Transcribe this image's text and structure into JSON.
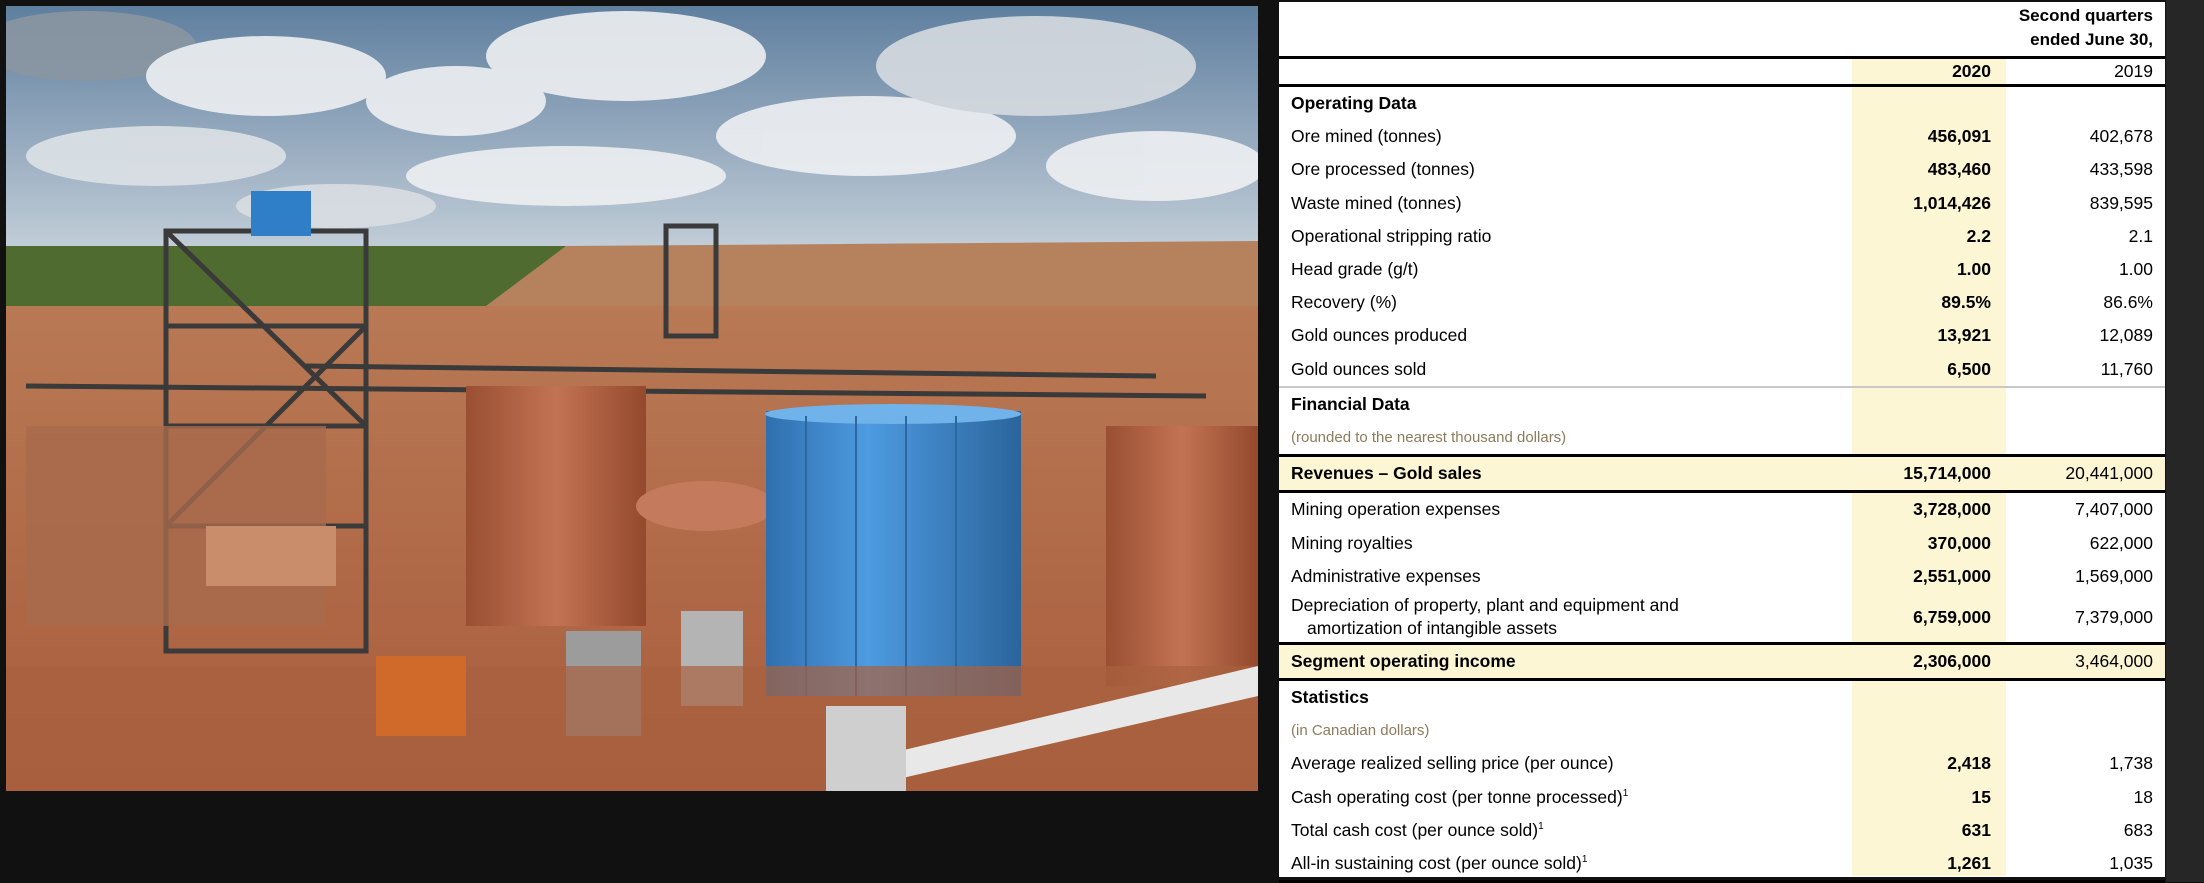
{
  "header": {
    "period_line1": "Second quarters",
    "period_line2": "ended June 30,",
    "col_2020": "2020",
    "col_2019": "2019"
  },
  "rows": [
    {
      "type": "section",
      "label": "Operating Data"
    },
    {
      "type": "data",
      "label": "Ore mined (tonnes)",
      "v2020": "456,091",
      "v2019": "402,678"
    },
    {
      "type": "data",
      "label": "Ore processed  (tonnes)",
      "v2020": "483,460",
      "v2019": "433,598"
    },
    {
      "type": "data",
      "label": "Waste mined (tonnes)",
      "v2020": "1,014,426",
      "v2019": "839,595"
    },
    {
      "type": "data",
      "label": "Operational stripping ratio",
      "v2020": "2.2",
      "v2019": "2.1"
    },
    {
      "type": "data",
      "label": "Head grade  (g/t)",
      "v2020": "1.00",
      "v2019": "1.00"
    },
    {
      "type": "data",
      "label": "Recovery (%)",
      "v2020": "89.5%",
      "v2019": "86.6%"
    },
    {
      "type": "data",
      "label": "Gold ounces produced",
      "v2020": "13,921",
      "v2019": "12,089"
    },
    {
      "type": "data",
      "label": "Gold ounces sold",
      "v2020": "6,500",
      "v2019": "11,760",
      "after": "gray"
    },
    {
      "type": "section",
      "label": "Financial Data"
    },
    {
      "type": "note",
      "label": "(rounded to the nearest thousand dollars)",
      "after": "thick"
    },
    {
      "type": "hl",
      "label": "Revenues – Gold sales",
      "v2020": "15,714,000",
      "v2019": "20,441,000",
      "after": "thick"
    },
    {
      "type": "data",
      "label": "Mining operation expenses",
      "v2020": "3,728,000",
      "v2019": "7,407,000"
    },
    {
      "type": "data",
      "label": "Mining royalties",
      "v2020": "370,000",
      "v2019": "622,000"
    },
    {
      "type": "data",
      "label": "Administrative expenses",
      "v2020": "2,551,000",
      "v2019": "1,569,000"
    },
    {
      "type": "multi",
      "label": "Depreciation of property, plant and equipment and",
      "label2": "amortization of intangible assets",
      "v2020": "6,759,000",
      "v2019": "7,379,000",
      "after": "thick"
    },
    {
      "type": "hl",
      "label": "Segment operating income",
      "v2020": "2,306,000",
      "v2019": "3,464,000",
      "after": "thick"
    },
    {
      "type": "section",
      "label": "Statistics"
    },
    {
      "type": "note",
      "label": "(in Canadian dollars)"
    },
    {
      "type": "data",
      "label": "Average realized selling price (per ounce)",
      "v2020": "2,418",
      "v2019": "1,738"
    },
    {
      "type": "data",
      "label": "Cash operating cost (per tonne processed)",
      "sup": "1",
      "v2020": "15",
      "v2019": "18"
    },
    {
      "type": "data",
      "label": "Total cash cost (per ounce sold)",
      "sup": "1",
      "v2020": "631",
      "v2019": "683"
    },
    {
      "type": "data",
      "label": "All-in sustaining cost (per ounce sold)",
      "sup": "1",
      "v2020": "1,261",
      "v2019": "1,035",
      "after": "thick"
    }
  ],
  "colors": {
    "highlight": "#fcf6d4",
    "note": "#8c7b5c",
    "tank_blue": "#3b8ad0",
    "ground": "#b86e4a"
  }
}
